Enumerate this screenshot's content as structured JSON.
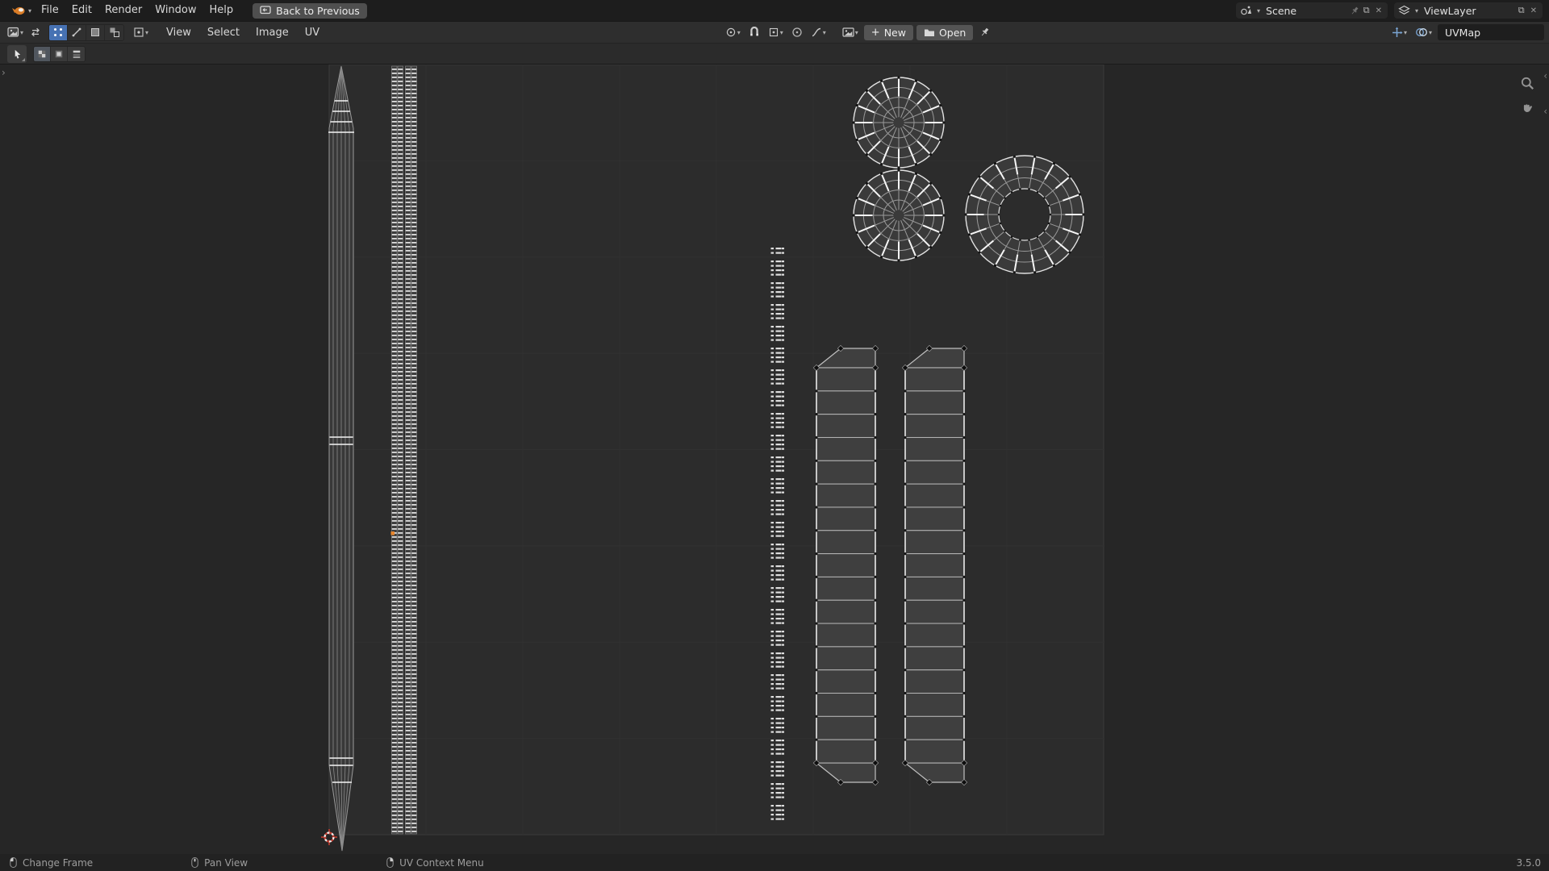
{
  "topbar": {
    "menus": [
      {
        "label": "File"
      },
      {
        "label": "Edit"
      },
      {
        "label": "Render"
      },
      {
        "label": "Window"
      },
      {
        "label": "Help"
      }
    ],
    "back_button": "Back to Previous",
    "scene": {
      "value": "Scene"
    },
    "view_layer": {
      "value": "ViewLayer"
    }
  },
  "editor_header": {
    "menus": [
      {
        "label": "View"
      },
      {
        "label": "Select"
      },
      {
        "label": "Image"
      },
      {
        "label": "UV"
      }
    ],
    "new_button": "New",
    "open_button": "Open",
    "uv_map_field": "UVMap"
  },
  "statusbar": {
    "items": [
      {
        "icon": "left-mouse-icon",
        "label": "Change Frame"
      },
      {
        "icon": "middle-mouse-icon",
        "label": "Pan View"
      },
      {
        "icon": "right-mouse-icon",
        "label": "UV Context Menu"
      }
    ],
    "version": "3.5.0"
  },
  "icons": {
    "chevron_down": "▾",
    "plus": "+",
    "close": "✕",
    "duplicate": "⧉",
    "expand_left": "‹",
    "expand_right": "›"
  },
  "colors": {
    "accent_blue": "#4772b3",
    "edge_gray": "#9a9a9a",
    "edge_light": "#c0c0c0",
    "selected_white": "#f5f5f5",
    "vertex_orange": "#e8862d",
    "cursor_red": "#c43e31",
    "face_fill": "#3f3f3f",
    "uv_area_bg": "#2c2c2c",
    "viewport_bg": "#262626",
    "grid_line": "#313131"
  }
}
